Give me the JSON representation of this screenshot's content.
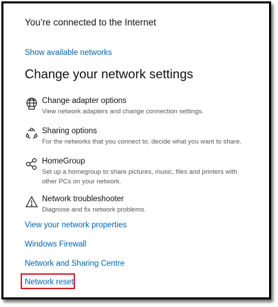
{
  "status": {
    "connected_text": "You’re connected to the Internet"
  },
  "links": {
    "show_networks": "Show available networks",
    "view_properties": "View your network properties",
    "firewall": "Windows Firewall",
    "sharing_centre": "Network and Sharing Centre",
    "network_reset": "Network reset"
  },
  "section": {
    "heading": "Change your network settings"
  },
  "options": [
    {
      "icon": "globe-adapter-icon",
      "title": "Change adapter options",
      "desc": "View network adapters and change connection settings."
    },
    {
      "icon": "sharing-icon",
      "title": "Sharing options",
      "desc": "For the networks that you connect to, decide what you want to share."
    },
    {
      "icon": "homegroup-icon",
      "title": "HomeGroup",
      "desc": "Set up a homegroup to share pictures, music, files and printers with other PCs on your network."
    },
    {
      "icon": "warning-icon",
      "title": "Network troubleshooter",
      "desc": "Diagnose and fix network problems."
    }
  ],
  "colors": {
    "link": "#0063b1",
    "highlight": "#d21f2a"
  }
}
